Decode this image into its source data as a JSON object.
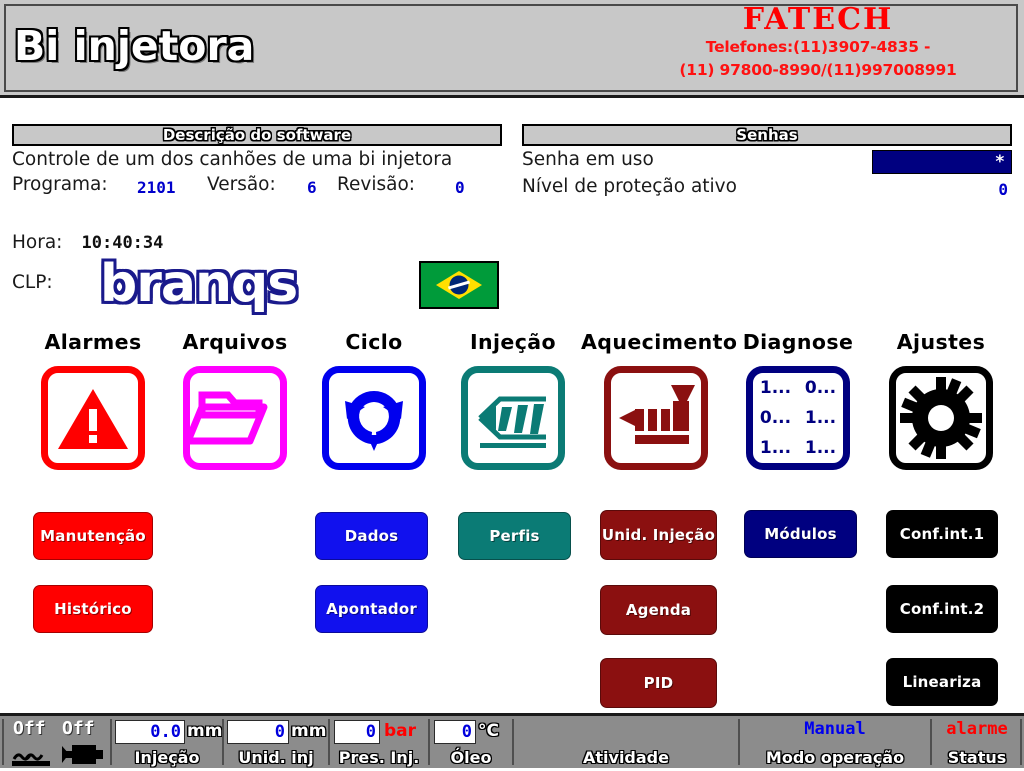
{
  "header": {
    "title": "Bi injetora",
    "brand_name": "FATECH",
    "brand_phone_line1": "Telefones:(11)3907-4835 -",
    "brand_phone_line2": "(11) 97800-8990/(11)997008991"
  },
  "software_panel": {
    "header": "Descrição do software",
    "description": "Controle de um dos canhões de uma bi injetora",
    "program_label": "Programa:",
    "program_value": "2101",
    "version_label": "Versão:",
    "version_value": "6",
    "revision_label": "Revisão:",
    "revision_value": "0"
  },
  "passwords_panel": {
    "header": "Senhas",
    "password_in_use_label": "Senha em uso",
    "password_in_use_value": "*",
    "protection_level_label": "Nível de proteção ativo",
    "protection_level_value": "0"
  },
  "info": {
    "time_label": "Hora:",
    "time_value": "10:40:34",
    "plc_label": "CLP:",
    "plc_brand": "branqs",
    "flag": "brazil-flag"
  },
  "menu": [
    {
      "title": "Alarmes",
      "icon": "warning-triangle-icon",
      "color": "#ff0000"
    },
    {
      "title": "Arquivos",
      "icon": "open-folder-icon",
      "color": "#ff00ff"
    },
    {
      "title": "Ciclo",
      "icon": "cycle-arrows-icon",
      "color": "#0000ee"
    },
    {
      "title": "Injeção",
      "icon": "injection-profile-icon",
      "color": "#0b7b75"
    },
    {
      "title": "Aquecimento",
      "icon": "extruder-barrel-icon",
      "color": "#8b1010"
    },
    {
      "title": "Diagnose",
      "icon": "binary-matrix-icon",
      "color": "#000080",
      "matrix": [
        "1...",
        "0...",
        "0...",
        "1...",
        "1...",
        "1..."
      ]
    },
    {
      "title": "Ajustes",
      "icon": "gear-icon",
      "color": "#000000"
    }
  ],
  "buttons": [
    {
      "label": "Manutenção",
      "color": "#ff0000",
      "col": 0,
      "row": 0
    },
    {
      "label": "Histórico",
      "color": "#ff0000",
      "col": 0,
      "row": 1
    },
    {
      "label": "Dados",
      "color": "#1111ee",
      "col": 2,
      "row": 0
    },
    {
      "label": "Apontador",
      "color": "#1111ee",
      "col": 2,
      "row": 1
    },
    {
      "label": "Perfis",
      "color": "#0b7b75",
      "col": 3,
      "row": 0
    },
    {
      "label": "Unid. Injeção",
      "color": "#8b1010",
      "col": 4,
      "row": 0
    },
    {
      "label": "Agenda",
      "color": "#8b1010",
      "col": 4,
      "row": 1
    },
    {
      "label": "PID",
      "color": "#8b1010",
      "col": 4,
      "row": 2
    },
    {
      "label": "Módulos",
      "color": "#000080",
      "col": 5,
      "row": 0
    },
    {
      "label": "Conf.int.1",
      "color": "#000000",
      "col": 6,
      "row": 0
    },
    {
      "label": "Conf.int.2",
      "color": "#000000",
      "col": 6,
      "row": 1
    },
    {
      "label": "Lineariza",
      "color": "#000000",
      "col": 6,
      "row": 2
    }
  ],
  "statusbar": {
    "heater_state": "Off",
    "motor_state": "Off",
    "heater_icon": "heat-waves-icon",
    "motor_icon": "motor-icon",
    "readings": [
      {
        "value": "0.0",
        "unit": "mm",
        "unit_color": "#ffffff",
        "label": "Injeção"
      },
      {
        "value": "0",
        "unit": "mm",
        "unit_color": "#ffffff",
        "label": "Unid. inj"
      },
      {
        "value": "0",
        "unit": "bar",
        "unit_color": "#ff0000",
        "label": "Pres. Inj."
      },
      {
        "value": "0",
        "unit": "°C",
        "unit_color": "#ffffff",
        "label": "Óleo"
      }
    ],
    "activity_value": "",
    "activity_label": "Atividade",
    "mode_value": "Manual",
    "mode_label": "Modo operação",
    "status_value": "alarme",
    "status_label": "Status"
  }
}
